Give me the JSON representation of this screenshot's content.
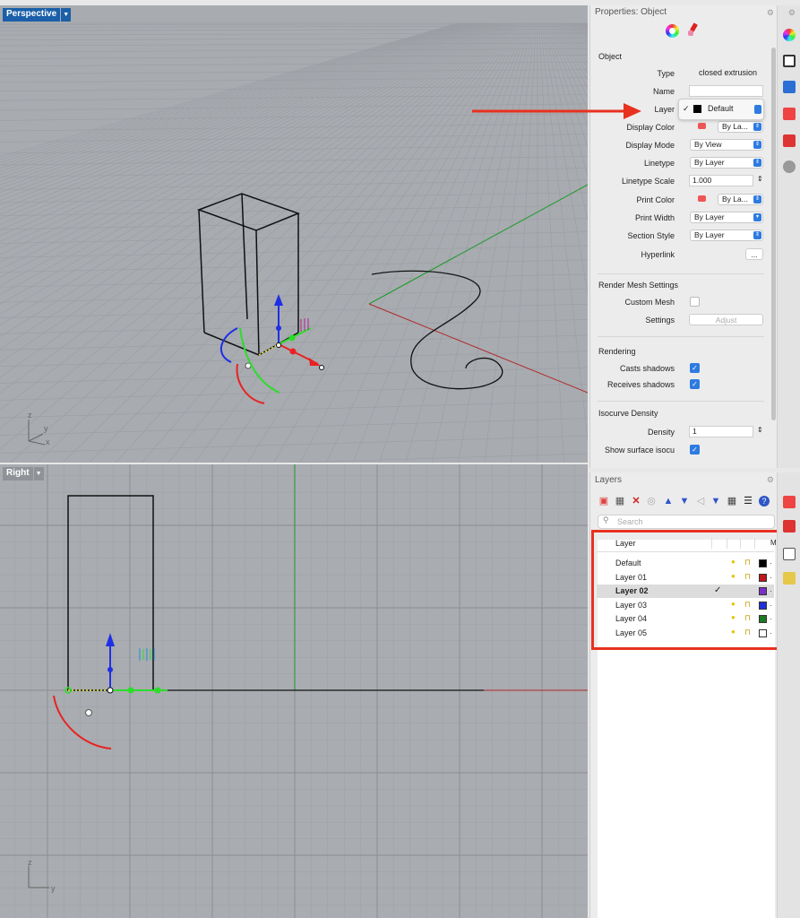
{
  "perspective_viewport": {
    "tab_label": "Perspective",
    "axis_labels": {
      "z": "z",
      "y": "y",
      "x": "x"
    }
  },
  "right_viewport": {
    "tab_label": "Right",
    "axis_labels": {
      "z": "z",
      "y": "y"
    }
  },
  "properties": {
    "title": "Properties: Object",
    "section_object": "Object",
    "type_label": "Type",
    "type_value": "closed extrusion",
    "name_label": "Name",
    "name_value": "",
    "layer_label": "Layer",
    "layer_popup": {
      "check": "✓",
      "value": "Default"
    },
    "display_color_label": "Display Color",
    "display_color_value": "By La...",
    "display_mode_label": "Display Mode",
    "display_mode_value": "By View",
    "linetype_label": "Linetype",
    "linetype_value": "By Layer",
    "linetype_scale_label": "Linetype Scale",
    "linetype_scale_value": "1.000",
    "print_color_label": "Print Color",
    "print_color_value": "By La...",
    "print_width_label": "Print Width",
    "print_width_value": "By Layer",
    "section_style_label": "Section Style",
    "section_style_value": "By Layer",
    "hyperlink_label": "Hyperlink",
    "hyperlink_button": "...",
    "section_render_mesh": "Render Mesh Settings",
    "custom_mesh_label": "Custom Mesh",
    "custom_mesh_checked": false,
    "settings_label": "Settings",
    "adjust_button": "Adjust",
    "section_rendering": "Rendering",
    "casts_shadows_label": "Casts shadows",
    "casts_shadows_checked": true,
    "receives_shadows_label": "Receives shadows",
    "receives_shadows_checked": true,
    "section_isocurve": "Isocurve Density",
    "density_label": "Density",
    "density_value": "1",
    "show_isocurves_label": "Show surface isocu",
    "show_isocurves_checked": true
  },
  "layers_panel": {
    "title": "Layers",
    "search_placeholder": "Search",
    "column_header": "Layer",
    "column_header_extra": "M",
    "rows": [
      {
        "name": "Default",
        "color": "#000000",
        "current": false
      },
      {
        "name": "Layer 01",
        "color": "#c0161c",
        "current": false
      },
      {
        "name": "Layer 02",
        "color": "#7a2fc4",
        "current": true
      },
      {
        "name": "Layer 03",
        "color": "#1f2fd6",
        "current": false
      },
      {
        "name": "Layer 04",
        "color": "#1e7a22",
        "current": false
      },
      {
        "name": "Layer 05",
        "color": "#ffffff",
        "current": false
      }
    ],
    "current_check": "✓"
  },
  "icons": {
    "property_tabs": [
      "color-wheel-icon",
      "texture-brush-icon"
    ],
    "right_sidebar": [
      "color-wheel-icon",
      "display-icon",
      "named-view-icon",
      "material-icon",
      "render-icon",
      "cloud-icon"
    ],
    "layers_toolbar": [
      "new-layer-icon",
      "new-sublayer-icon",
      "delete-icon",
      "copy-icon",
      "move-up-icon",
      "move-down-icon",
      "move-back-icon",
      "filter-icon",
      "table-icon",
      "menu-icon",
      "help-icon"
    ]
  },
  "annotation_colors": {
    "arrow": "#e8311f",
    "highlight_box": "#e8311f"
  }
}
